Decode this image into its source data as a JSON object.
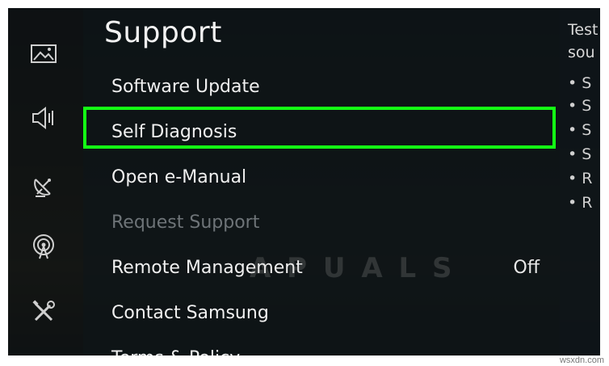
{
  "settings_panel": {
    "title": "Support",
    "items": [
      {
        "label": "Software Update",
        "value": "",
        "enabled": true
      },
      {
        "label": "Self Diagnosis",
        "value": "",
        "enabled": true,
        "highlighted": true
      },
      {
        "label": "Open e-Manual",
        "value": "",
        "enabled": true
      },
      {
        "label": "Request Support",
        "value": "",
        "enabled": false
      },
      {
        "label": "Remote Management",
        "value": "Off",
        "enabled": true
      },
      {
        "label": "Contact Samsung",
        "value": "",
        "enabled": true
      },
      {
        "label": "Terms & Policy",
        "value": "",
        "enabled": true
      }
    ]
  },
  "category_rail": {
    "icons": [
      "picture-icon",
      "sound-icon",
      "broadcasting-icon",
      "network-icon",
      "support-tools-icon"
    ]
  },
  "description_panel": {
    "lines": [
      "Test",
      "sou"
    ],
    "bullets": [
      "• S",
      "• S",
      "• S",
      "• S",
      "• R",
      "• R"
    ]
  },
  "watermark": "A PUALS",
  "credit": "wsxdn.com",
  "colors": {
    "highlight": "#14ff14",
    "background": "#0b0f12",
    "text": "#f0f0f0",
    "disabled_text": "#6e7478"
  }
}
